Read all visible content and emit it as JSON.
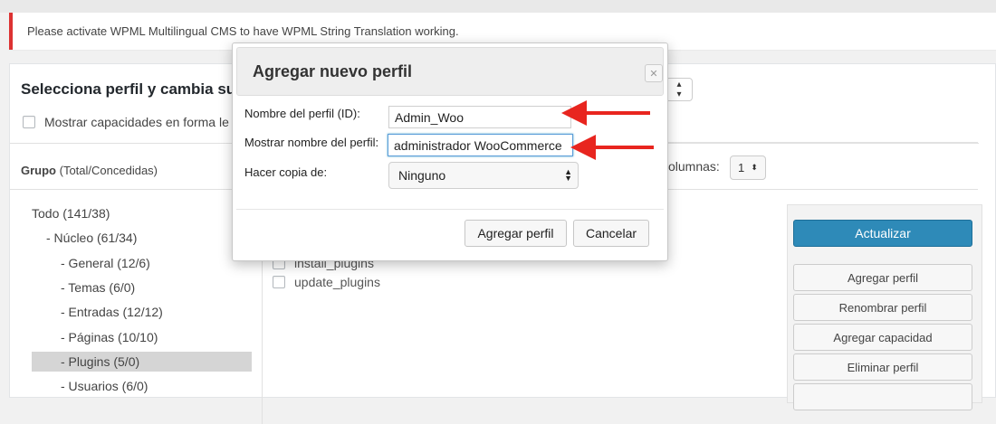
{
  "notice": {
    "text": "Please activate WPML Multilingual CMS to have WPML String Translation working.",
    "accent_color": "#dc3232"
  },
  "page": {
    "title_partial": "Selecciona perfil y cambia su",
    "show_caps_label_partial": "Mostrar capacidades en forma le",
    "group_label": "Grupo",
    "group_suffix": "(Total/Concedidas)",
    "columns_label_partial": "olumnas:",
    "columns_value": "1",
    "tree": [
      {
        "label": "Todo (141/38)",
        "selected": false
      },
      {
        "label": "- Núcleo (61/34)",
        "selected": false
      },
      {
        "label": "- General (12/6)",
        "selected": false
      },
      {
        "label": "- Temas (6/0)",
        "selected": false
      },
      {
        "label": "- Entradas (12/12)",
        "selected": false
      },
      {
        "label": "- Páginas (10/10)",
        "selected": false
      },
      {
        "label": "- Plugins (5/0)",
        "selected": true
      },
      {
        "label": "- Usuarios (6/0)",
        "selected": false
      }
    ],
    "capabilities": [
      "install_plugins",
      "update_plugins"
    ],
    "side_buttons": {
      "primary": "Actualizar",
      "add_role": "Agregar perfil",
      "rename_role": "Renombrar perfil",
      "add_capability": "Agregar capacidad",
      "delete_role": "Eliminar perfil"
    },
    "primary_color": "#2e8ab8"
  },
  "modal": {
    "title": "Agregar nuevo perfil",
    "close_icon": "close-icon",
    "fields": {
      "id_label": "Nombre del perfil (ID):",
      "id_value": "Admin_Woo",
      "display_label": "Mostrar nombre del perfil:",
      "display_value": "administrador WooCommerce",
      "copy_label": "Hacer copia de:",
      "copy_value": "Ninguno"
    },
    "buttons": {
      "add": "Agregar perfil",
      "cancel": "Cancelar"
    }
  },
  "annotation_color": "#e8251f"
}
